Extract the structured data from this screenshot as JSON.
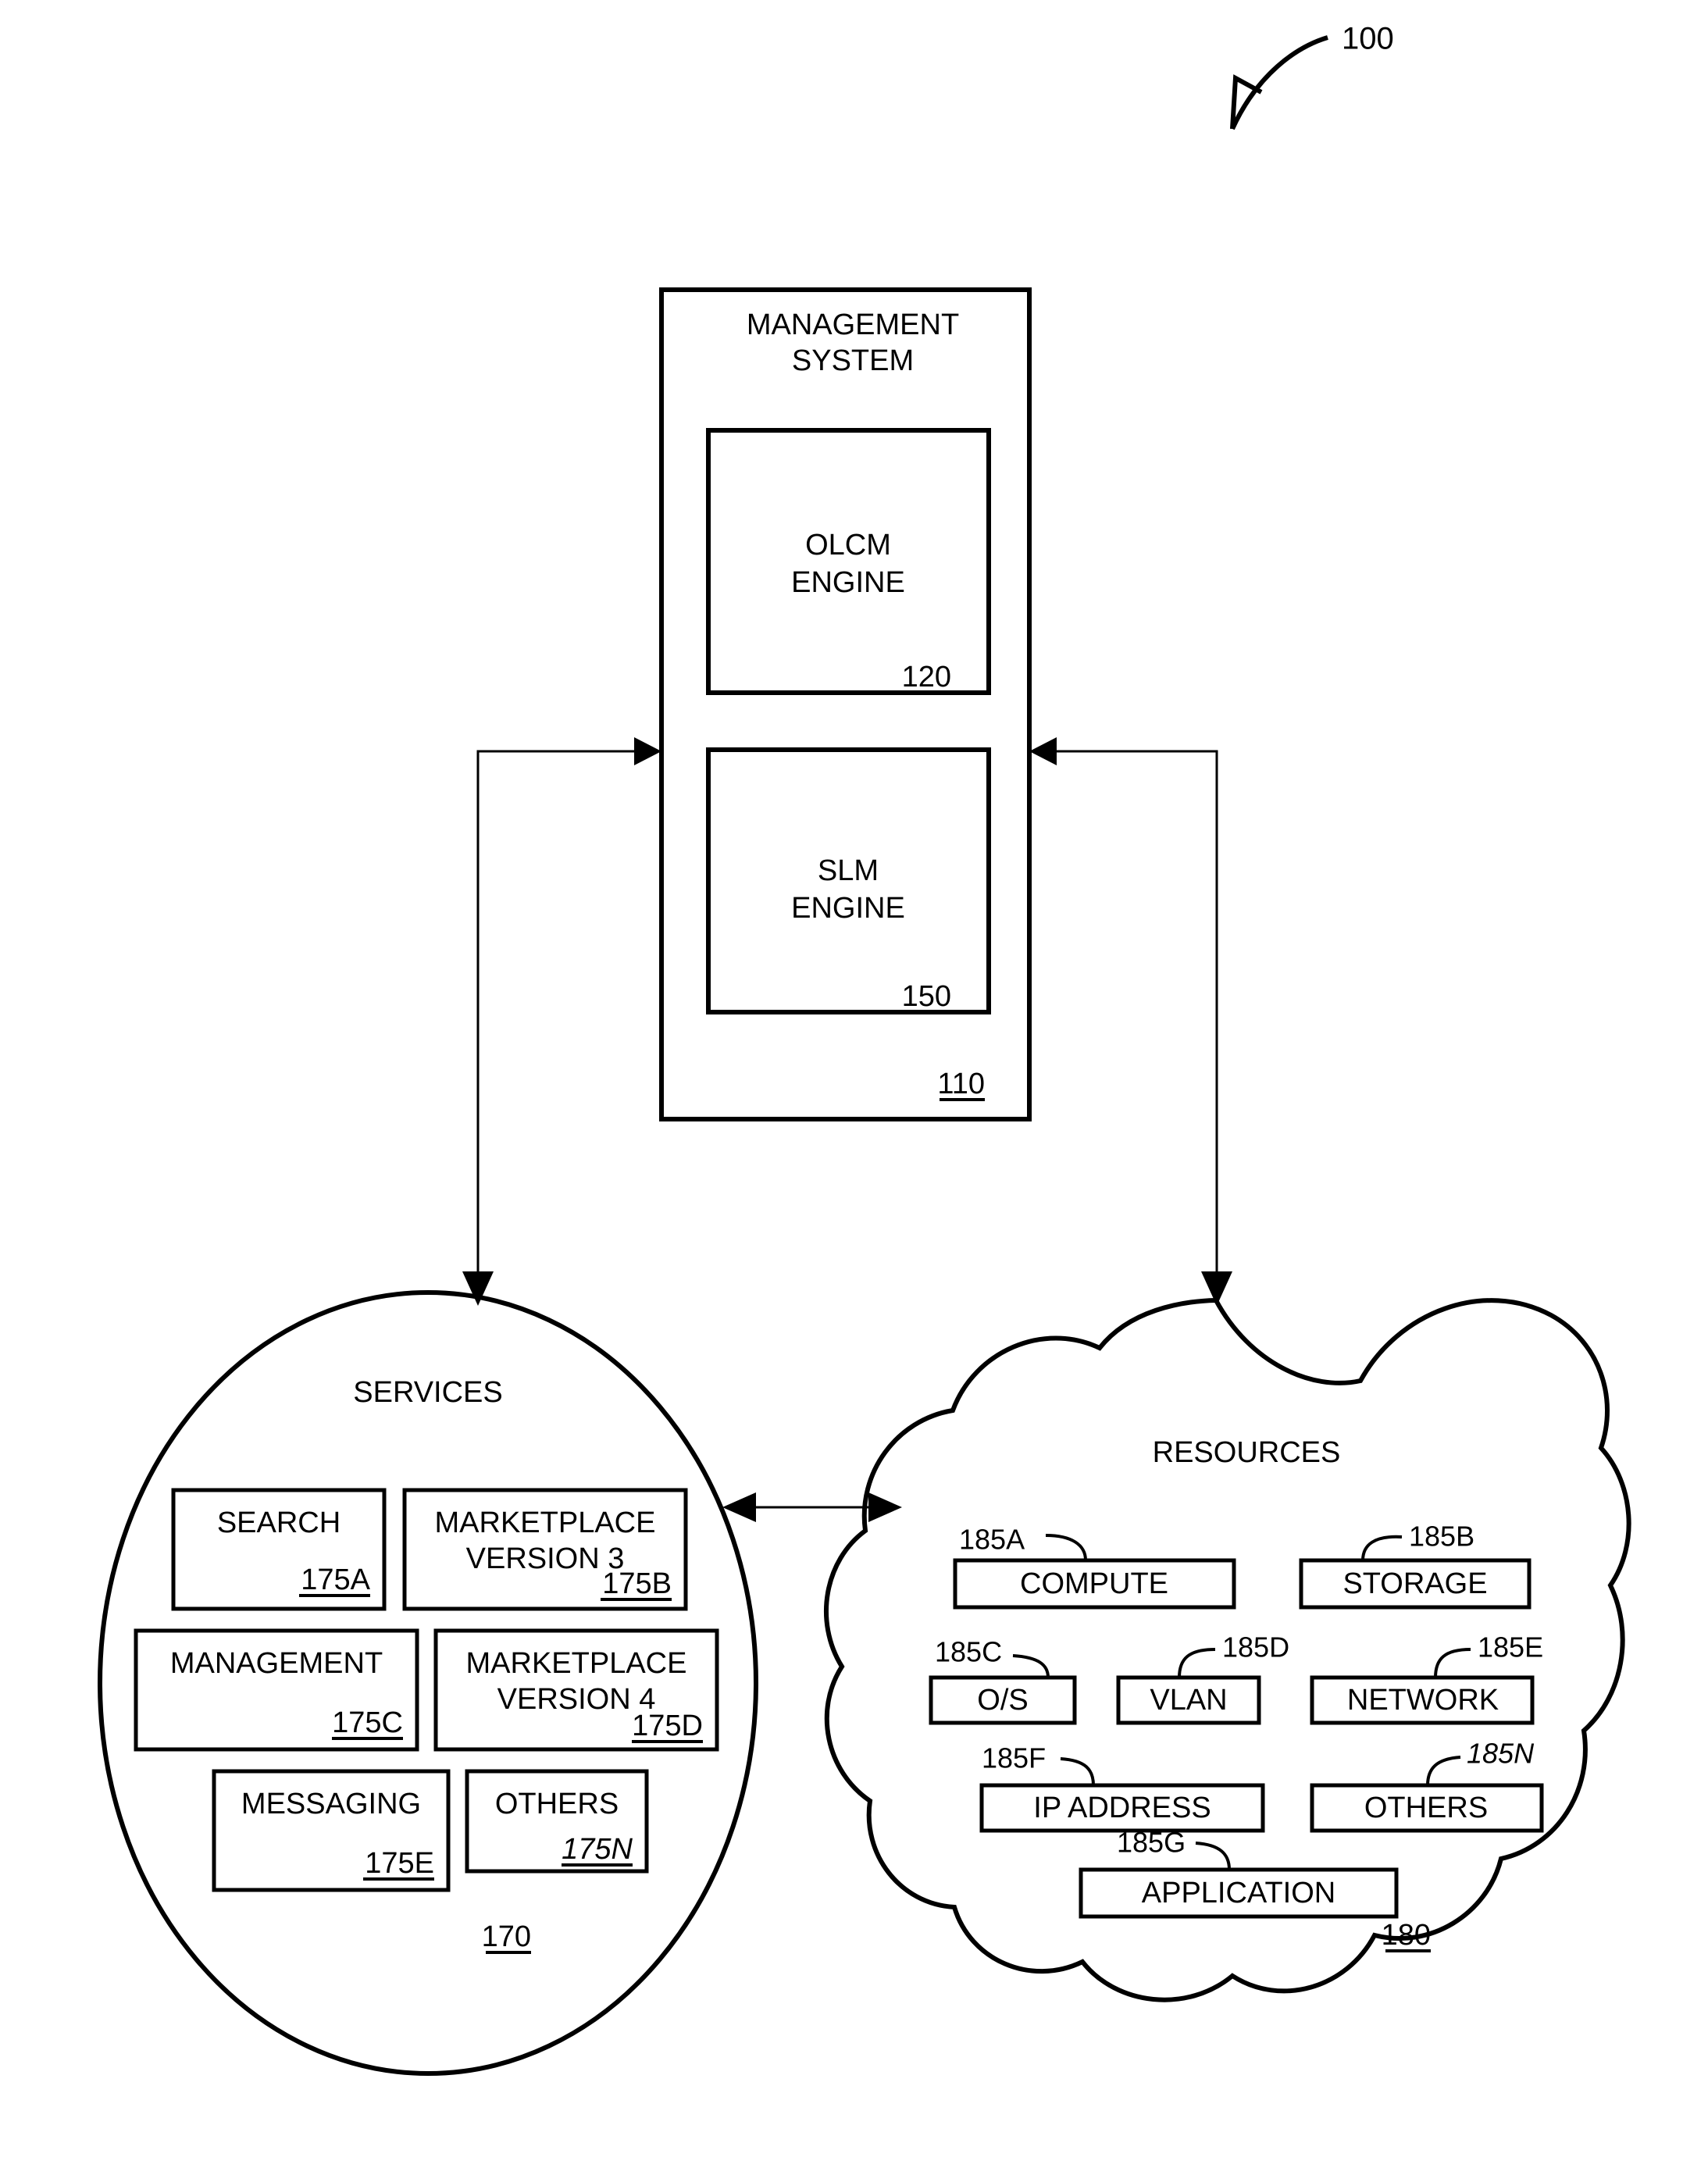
{
  "figure": {
    "number_label": "100"
  },
  "management_system": {
    "title_line1": "MANAGEMENT",
    "title_line2": "SYSTEM",
    "ref": "110",
    "engines": [
      {
        "line1": "OLCM",
        "line2": "ENGINE",
        "ref": "120"
      },
      {
        "line1": "SLM",
        "line2": "ENGINE",
        "ref": "150"
      }
    ]
  },
  "services": {
    "title": "SERVICES",
    "ref": "170",
    "items": [
      {
        "line1": "SEARCH",
        "line2": "",
        "ref": "175A",
        "ref_italic": false
      },
      {
        "line1": "MARKETPLACE",
        "line2": "VERSION 3",
        "ref": "175B",
        "ref_italic": false
      },
      {
        "line1": "MANAGEMENT",
        "line2": "",
        "ref": "175C",
        "ref_italic": false
      },
      {
        "line1": "MARKETPLACE",
        "line2": "VERSION 4",
        "ref": "175D",
        "ref_italic": false
      },
      {
        "line1": "MESSAGING",
        "line2": "",
        "ref": "175E",
        "ref_italic": false
      },
      {
        "line1": "OTHERS",
        "line2": "",
        "ref": "175N",
        "ref_italic": true
      }
    ]
  },
  "resources": {
    "title": "RESOURCES",
    "ref": "180",
    "items": [
      {
        "label": "COMPUTE",
        "ref": "185A",
        "ref_italic": false
      },
      {
        "label": "STORAGE",
        "ref": "185B",
        "ref_italic": false
      },
      {
        "label": "O/S",
        "ref": "185C",
        "ref_italic": false
      },
      {
        "label": "VLAN",
        "ref": "185D",
        "ref_italic": false
      },
      {
        "label": "NETWORK",
        "ref": "185E",
        "ref_italic": false
      },
      {
        "label": "IP ADDRESS",
        "ref": "185F",
        "ref_italic": false
      },
      {
        "label": "OTHERS",
        "ref": "185N",
        "ref_italic": true
      },
      {
        "label": "APPLICATION",
        "ref": "185G",
        "ref_italic": false
      }
    ]
  },
  "connectors": {
    "services_to_management": "arrow-services-to-management",
    "resources_to_management": "arrow-resources-to-management",
    "management_to_services": "arrow-management-to-services",
    "management_to_resources": "arrow-management-to-resources",
    "services_resources_bidirectional": "arrow-services-resources"
  },
  "colors": {
    "stroke": "#000000",
    "background": "#ffffff"
  }
}
